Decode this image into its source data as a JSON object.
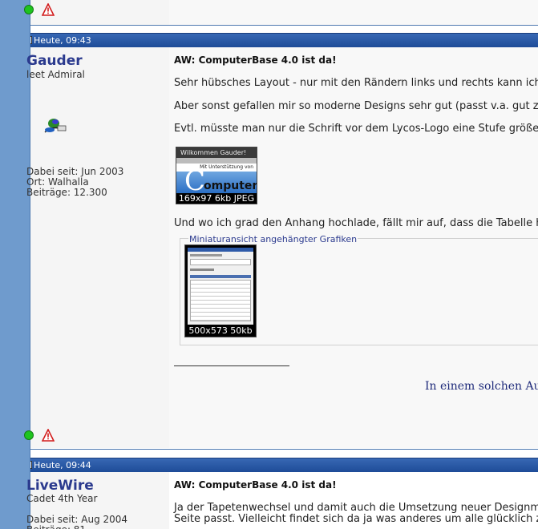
{
  "post1": {
    "header_date": "Heute, 09:43",
    "username": "Gauder",
    "rank": "leet Admiral",
    "joined": "Dabei seit: Jun 2003",
    "location": "Ort: Walhalla",
    "posts": "Beiträge: 12.300",
    "title": "AW: ComputerBase 4.0 ist da!",
    "paragraphs": [
      "Sehr hübsches Layout - nur mit den Rändern links und rechts kann ich m",
      "Aber sonst gefallen mir so moderne Designs sehr gut (passt v.a. gut zu",
      "Evtl. müsste man nur die Schrift vor dem Lycos-Logo eine Stufe größer m",
      "Und wo ich grad den Anhang hochlade, fällt mir auf, dass die Tabelle hie"
    ],
    "inline_image": {
      "welcome_text": "Wilkommen Gauder!",
      "support_text": "Mit Unterstützung von",
      "logo_text": "omputer",
      "logo_letter": "C",
      "caption": "169x97  6kb  JPEG"
    },
    "attachments_legend": "Miniaturansicht angehängter Grafiken",
    "attachment_caption": "500x573  50kb",
    "signature": "In einem solchen Aug"
  },
  "post2": {
    "header_date": "Heute, 09:44",
    "username": "LiveWire",
    "rank": "Cadet 4th Year",
    "joined": "Dabei seit: Aug 2004",
    "title": "AW: ComputerBase 4.0 ist da!",
    "paragraphs": [
      "Ja der Tapetenwechsel und damit auch die Umsetzung neuer Designmög",
      "Seite passt. Vielleicht findet sich da ja was anderes um alle glücklich zu"
    ]
  },
  "colors": {
    "header_bar": "#1e4c98",
    "username": "#2b3a8e",
    "left_bar": "#6f9bcd"
  }
}
